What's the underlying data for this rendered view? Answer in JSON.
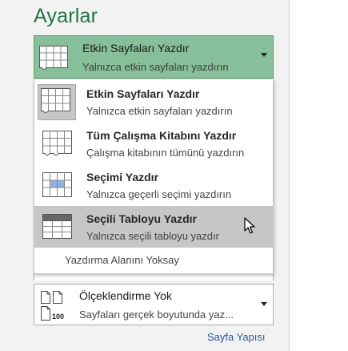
{
  "title": "Ayarlar",
  "selected": {
    "label": "Etkin Sayfaları Yazdır",
    "description": "Yalnızca etkin sayfaları yazdırın",
    "icon": "active-sheets-icon"
  },
  "menu": {
    "items": [
      {
        "label": "Etkin Sayfaları Yazdır",
        "description": "Yalnızca etkin sayfaları yazdırın",
        "icon": "active-sheets-icon"
      },
      {
        "label": "Tüm Çalışma Kitabını Yazdır",
        "description": "Çalışma kitabının tümünü yazdırın",
        "icon": "workbook-icon"
      },
      {
        "label": "Seçimi Yazdır",
        "description": "Yalnızca geçerli seçimi yazdırın",
        "icon": "selection-icon"
      },
      {
        "label": "Seçili Tabloyu Yazdır",
        "description": "Yalnızca seçili tabloyu yazdır",
        "icon": "table-icon"
      }
    ],
    "ignore_print_area": "Yazdırma Alanını Yoksay"
  },
  "scaling": {
    "label": "Ölçeklendirme Yok",
    "description": "Sayfaları gerçek boyutunda yaz...",
    "icon": "scaling-icon",
    "icon_number": "100"
  },
  "page_setup_link": "Sayfa Yapısı",
  "colors": {
    "title": "#217346",
    "selected_bg": "#86bf99",
    "hover_bg": "#c6c6c6",
    "link": "#2b579a"
  }
}
